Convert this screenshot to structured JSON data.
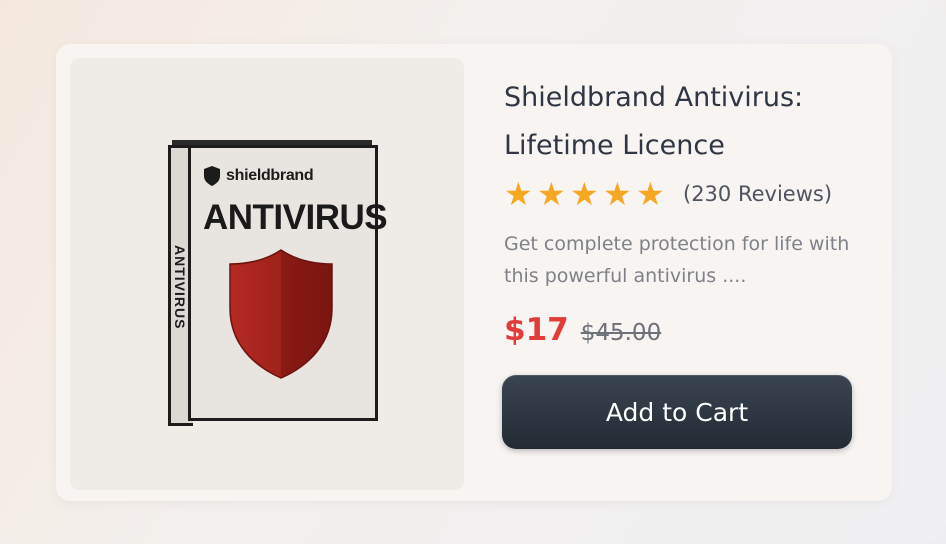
{
  "product": {
    "title": "Shieldbrand Antivirus: Lifetime Licence",
    "rating": 5,
    "reviews_text": "(230 Reviews)",
    "description": "Get complete protection for life with this powerful antivirus ....",
    "price_current": "$17",
    "price_original": "$45.00",
    "add_to_cart_label": "Add to Cart"
  },
  "box_art": {
    "brand_name": "shieldbrand",
    "front_title": "ANTIVIRUS",
    "side_title": "ANTIVIRUS"
  },
  "colors": {
    "star": "#f6a823",
    "price_current": "#e23c3a",
    "button_bg": "#2a333c",
    "shield_red": "#a2211b"
  }
}
